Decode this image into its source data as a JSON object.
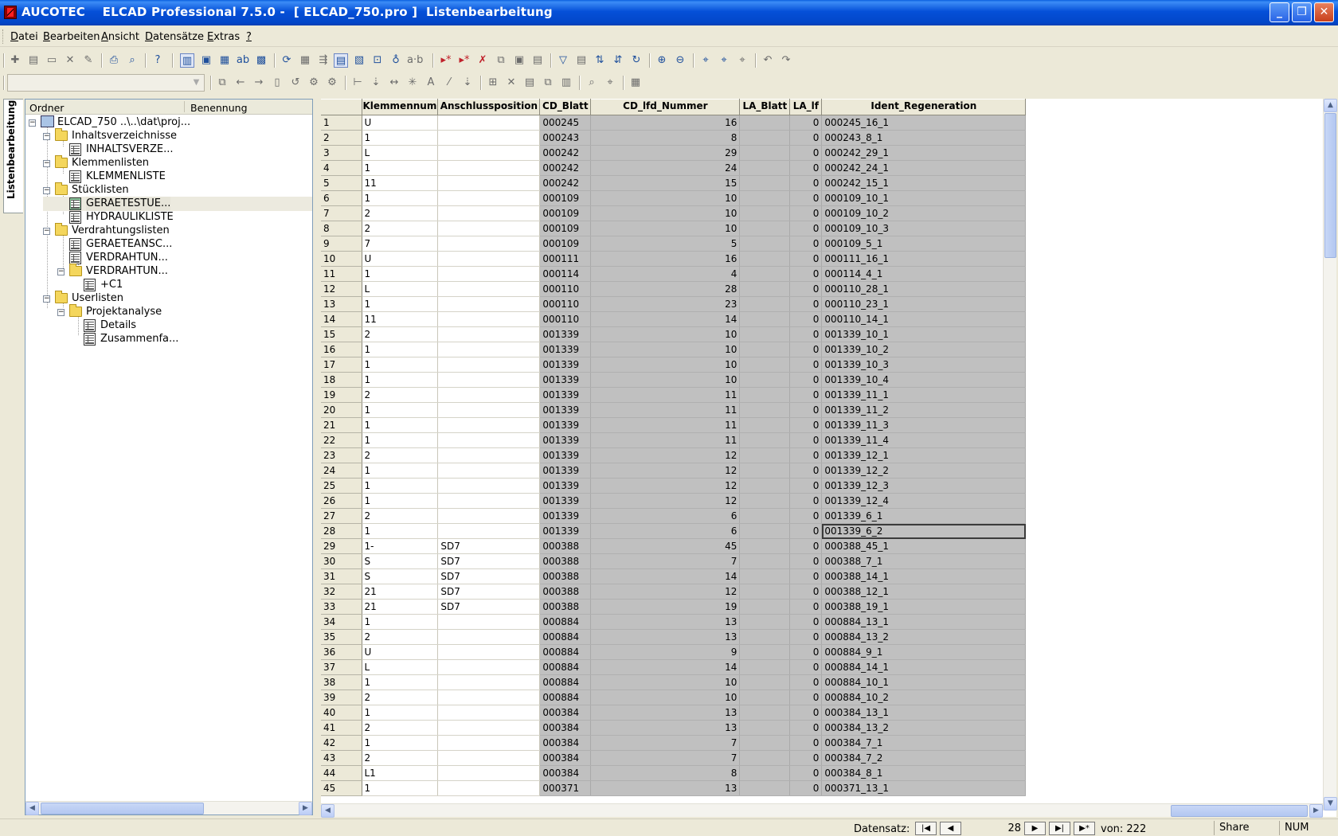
{
  "window": {
    "title": "AUCOTEC    ELCAD Professional 7.5.0 -  [ ELCAD_750.pro ]  Listenbearbeitung",
    "min_label": "_",
    "max_label": "❐",
    "close_label": "✕"
  },
  "menu": [
    {
      "label": "Datei"
    },
    {
      "label": "Bearbeiten"
    },
    {
      "label": "Ansicht"
    },
    {
      "label": "Datensätze"
    },
    {
      "label": "Extras"
    },
    {
      "label": "?"
    }
  ],
  "side_tab": "Listenbearbeitung",
  "tree": {
    "col_ordner": "Ordner",
    "col_benennung": "Benennung",
    "nodes": [
      {
        "label": "ELCAD_750 ..\\..\\dat\\proj..."
      },
      {
        "label": "Inhaltsverzeichnisse"
      },
      {
        "label": "INHALTSVERZE..."
      },
      {
        "label": "Klemmenlisten"
      },
      {
        "label": "KLEMMENLISTE"
      },
      {
        "label": "Stücklisten"
      },
      {
        "label": "GERAETESTUE..."
      },
      {
        "label": "HYDRAULIKLISTE"
      },
      {
        "label": "Verdrahtungslisten"
      },
      {
        "label": "GERAETEANSC..."
      },
      {
        "label": "VERDRAHTUN..."
      },
      {
        "label": "VERDRAHTUN..."
      },
      {
        "label": "+C1"
      },
      {
        "label": "Userlisten"
      },
      {
        "label": "Projektanalyse"
      },
      {
        "label": "Details"
      },
      {
        "label": "Zusammenfa..."
      }
    ]
  },
  "grid": {
    "columns": [
      "Klemmennum",
      "Anschlussposition",
      "CD_Blatt",
      "CD_lfd_Nummer",
      "LA_Blatt",
      "LA_lf",
      "Ident_Regeneration"
    ],
    "rows": [
      [
        "1",
        "U",
        "",
        "000245",
        "16",
        "0",
        "000245_16_1"
      ],
      [
        "2",
        "1",
        "",
        "000243",
        "8",
        "0",
        "000243_8_1"
      ],
      [
        "3",
        "L",
        "",
        "000242",
        "29",
        "0",
        "000242_29_1"
      ],
      [
        "4",
        "1",
        "",
        "000242",
        "24",
        "0",
        "000242_24_1"
      ],
      [
        "5",
        "11",
        "",
        "000242",
        "15",
        "0",
        "000242_15_1"
      ],
      [
        "6",
        "1",
        "",
        "000109",
        "10",
        "0",
        "000109_10_1"
      ],
      [
        "7",
        "2",
        "",
        "000109",
        "10",
        "0",
        "000109_10_2"
      ],
      [
        "8",
        "2",
        "",
        "000109",
        "10",
        "0",
        "000109_10_3"
      ],
      [
        "9",
        "7",
        "",
        "000109",
        "5",
        "0",
        "000109_5_1"
      ],
      [
        "10",
        "U",
        "",
        "000111",
        "16",
        "0",
        "000111_16_1"
      ],
      [
        "11",
        "1",
        "",
        "000114",
        "4",
        "0",
        "000114_4_1"
      ],
      [
        "12",
        "L",
        "",
        "000110",
        "28",
        "0",
        "000110_28_1"
      ],
      [
        "13",
        "1",
        "",
        "000110",
        "23",
        "0",
        "000110_23_1"
      ],
      [
        "14",
        "11",
        "",
        "000110",
        "14",
        "0",
        "000110_14_1"
      ],
      [
        "15",
        "2",
        "",
        "001339",
        "10",
        "0",
        "001339_10_1"
      ],
      [
        "16",
        "1",
        "",
        "001339",
        "10",
        "0",
        "001339_10_2"
      ],
      [
        "17",
        "1",
        "",
        "001339",
        "10",
        "0",
        "001339_10_3"
      ],
      [
        "18",
        "1",
        "",
        "001339",
        "10",
        "0",
        "001339_10_4"
      ],
      [
        "19",
        "2",
        "",
        "001339",
        "11",
        "0",
        "001339_11_1"
      ],
      [
        "20",
        "1",
        "",
        "001339",
        "11",
        "0",
        "001339_11_2"
      ],
      [
        "21",
        "1",
        "",
        "001339",
        "11",
        "0",
        "001339_11_3"
      ],
      [
        "22",
        "1",
        "",
        "001339",
        "11",
        "0",
        "001339_11_4"
      ],
      [
        "23",
        "2",
        "",
        "001339",
        "12",
        "0",
        "001339_12_1"
      ],
      [
        "24",
        "1",
        "",
        "001339",
        "12",
        "0",
        "001339_12_2"
      ],
      [
        "25",
        "1",
        "",
        "001339",
        "12",
        "0",
        "001339_12_3"
      ],
      [
        "26",
        "1",
        "",
        "001339",
        "12",
        "0",
        "001339_12_4"
      ],
      [
        "27",
        "2",
        "",
        "001339",
        "6",
        "0",
        "001339_6_1"
      ],
      [
        "28",
        "1",
        "",
        "001339",
        "6",
        "0",
        "001339_6_2"
      ],
      [
        "29",
        "1-",
        "SD7",
        "000388",
        "45",
        "0",
        "000388_45_1"
      ],
      [
        "30",
        "S",
        "SD7",
        "000388",
        "7",
        "0",
        "000388_7_1"
      ],
      [
        "31",
        "S",
        "SD7",
        "000388",
        "14",
        "0",
        "000388_14_1"
      ],
      [
        "32",
        "21",
        "SD7",
        "000388",
        "12",
        "0",
        "000388_12_1"
      ],
      [
        "33",
        "21",
        "SD7",
        "000388",
        "19",
        "0",
        "000388_19_1"
      ],
      [
        "34",
        "1",
        "",
        "000884",
        "13",
        "0",
        "000884_13_1"
      ],
      [
        "35",
        "2",
        "",
        "000884",
        "13",
        "0",
        "000884_13_2"
      ],
      [
        "36",
        "U",
        "",
        "000884",
        "9",
        "0",
        "000884_9_1"
      ],
      [
        "37",
        "L",
        "",
        "000884",
        "14",
        "0",
        "000884_14_1"
      ],
      [
        "38",
        "1",
        "",
        "000884",
        "10",
        "0",
        "000884_10_1"
      ],
      [
        "39",
        "2",
        "",
        "000884",
        "10",
        "0",
        "000884_10_2"
      ],
      [
        "40",
        "1",
        "",
        "000384",
        "13",
        "0",
        "000384_13_1"
      ],
      [
        "41",
        "2",
        "",
        "000384",
        "13",
        "0",
        "000384_13_2"
      ],
      [
        "42",
        "1",
        "",
        "000384",
        "7",
        "0",
        "000384_7_1"
      ],
      [
        "43",
        "2",
        "",
        "000384",
        "7",
        "0",
        "000384_7_2"
      ],
      [
        "44",
        "L1",
        "",
        "000384",
        "8",
        "0",
        "000384_8_1"
      ],
      [
        "45",
        "1",
        "",
        "000371",
        "13",
        "0",
        "000371_13_1"
      ]
    ]
  },
  "status": {
    "datensatz_label": "Datensatz:",
    "current_record": "28",
    "of_label": "von: 222",
    "share": "Share",
    "num": "NUM"
  },
  "colors": {
    "title_bar": "#0550d8",
    "readonly_column": "#c0c0c0",
    "face": "#ece9d8"
  }
}
